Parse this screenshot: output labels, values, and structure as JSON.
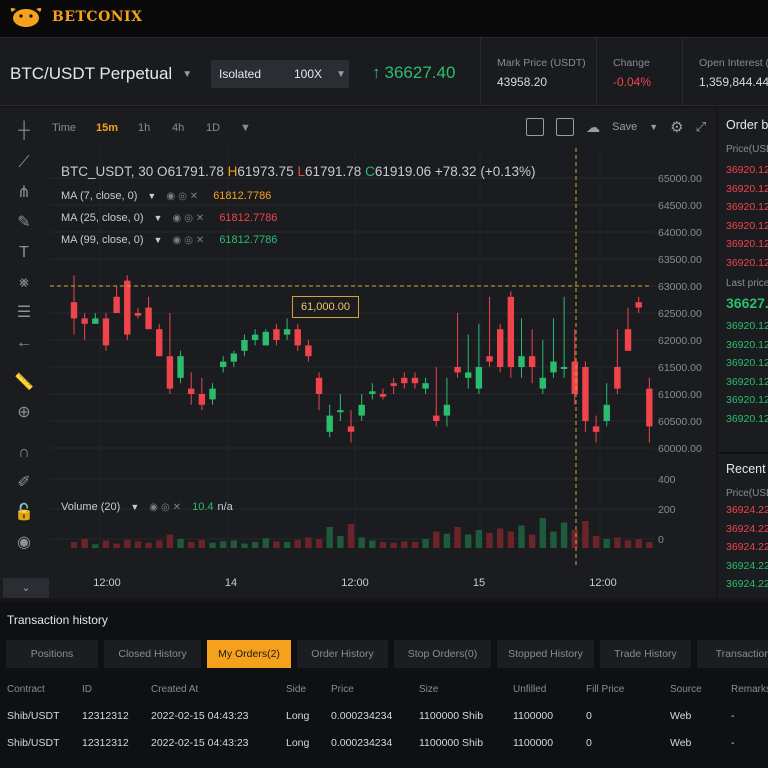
{
  "brand": {
    "name": "BETCONIX",
    "logo_icon": "bull-logo-icon"
  },
  "ticker": {
    "pair": "BTC/USDT Perpetual",
    "margin_mode": "Isolated",
    "leverage": "100X",
    "last_price": "36627.40",
    "stats": [
      {
        "label": "Mark Price (USDT)",
        "value": "43958.20",
        "negative": false
      },
      {
        "label": "Change",
        "value": "-0.04%",
        "negative": true
      },
      {
        "label": "Open Interest (U",
        "value": "1,359,844.44",
        "negative": false
      }
    ]
  },
  "chart_toolbar": {
    "timeframes": [
      "Time",
      "15m",
      "1h",
      "4h",
      "1D"
    ],
    "active_timeframe": "15m",
    "save_label": "Save"
  },
  "legend": {
    "symbol": "BTC_USDT, 30",
    "o_label": "O",
    "o": "61791.78",
    "h_label": "H",
    "h": "61973.75",
    "l_label": "L",
    "l": "61791.78",
    "c_label": "C",
    "c": "61919.06",
    "change": "+78.32",
    "change_pct": "(+0.13%)"
  },
  "indicators": [
    {
      "label": "MA (7, close, 0)",
      "value": "61812.7786",
      "color": "#f5a11c"
    },
    {
      "label": "MA (25, close, 0)",
      "value": "61812.7786",
      "color": "#f0444d"
    },
    {
      "label": "MA (99, close, 0)",
      "value": "61812.7786",
      "color": "#2bbd6e"
    }
  ],
  "volume_indicator": {
    "label": "Volume (20)",
    "value": "10.4",
    "extra": "n/a"
  },
  "crosshair_price": "61,000.00",
  "chart_data": {
    "type": "candlestick",
    "price_axis": [
      "65000.00",
      "64500.00",
      "64000.00",
      "63500.00",
      "63000.00",
      "62500.00",
      "62000.00",
      "61500.00",
      "61000.00",
      "60500.00",
      "60000.00"
    ],
    "volume_axis": [
      "400",
      "200",
      "0"
    ],
    "ylim": [
      60000,
      65000
    ],
    "x_labels": [
      "12:00",
      "14",
      "12:00",
      "15",
      "12:00"
    ],
    "candles": [
      [
        62700,
        63200,
        62100,
        62400
      ],
      [
        62400,
        62500,
        62000,
        62300
      ],
      [
        62300,
        62500,
        62300,
        62400
      ],
      [
        62400,
        62500,
        61800,
        61900
      ],
      [
        62800,
        63000,
        62500,
        62500
      ],
      [
        63100,
        63200,
        62000,
        62100
      ],
      [
        62500,
        62600,
        62400,
        62450
      ],
      [
        62600,
        62800,
        62200,
        62200
      ],
      [
        62200,
        62300,
        61700,
        61700
      ],
      [
        61700,
        62500,
        61000,
        61100
      ],
      [
        61300,
        61800,
        61200,
        61700
      ],
      [
        61100,
        61400,
        60800,
        61000
      ],
      [
        61000,
        61300,
        60700,
        60800
      ],
      [
        60900,
        61200,
        60800,
        61100
      ],
      [
        61500,
        61700,
        61400,
        61600
      ],
      [
        61600,
        61800,
        61500,
        61750
      ],
      [
        61800,
        62100,
        61700,
        62000
      ],
      [
        62000,
        62200,
        61900,
        62100
      ],
      [
        61900,
        62200,
        61900,
        62150
      ],
      [
        62200,
        62300,
        61900,
        62000
      ],
      [
        62100,
        62400,
        62000,
        62200
      ],
      [
        62200,
        62300,
        61800,
        61900
      ],
      [
        61900,
        62000,
        61600,
        61700
      ],
      [
        61300,
        61400,
        60700,
        61000
      ],
      [
        60300,
        60800,
        60200,
        60600
      ],
      [
        60700,
        61000,
        60500,
        60700
      ],
      [
        60400,
        60700,
        60100,
        60300
      ],
      [
        60600,
        61000,
        60500,
        60800
      ],
      [
        61000,
        61200,
        60900,
        61050
      ],
      [
        61000,
        61100,
        60900,
        60950
      ],
      [
        61200,
        61300,
        61000,
        61150
      ],
      [
        61300,
        61400,
        61100,
        61200
      ],
      [
        61300,
        61400,
        61100,
        61200
      ],
      [
        61100,
        61300,
        61000,
        61200
      ],
      [
        60600,
        61500,
        60400,
        60500
      ],
      [
        60600,
        61300,
        60400,
        60800
      ],
      [
        61500,
        62500,
        61300,
        61400
      ],
      [
        61300,
        62100,
        61100,
        61400
      ],
      [
        61100,
        62300,
        61000,
        61500
      ],
      [
        61700,
        62800,
        61500,
        61600
      ],
      [
        62200,
        62300,
        61400,
        61500
      ],
      [
        62800,
        62900,
        61300,
        61500
      ],
      [
        61500,
        62400,
        61300,
        61700
      ],
      [
        61700,
        62200,
        61200,
        61500
      ],
      [
        61100,
        62000,
        61000,
        61300
      ],
      [
        61400,
        62400,
        61300,
        61600
      ],
      [
        61500,
        62800,
        61300,
        61500
      ],
      [
        61600,
        62200,
        60800,
        61000
      ],
      [
        61500,
        61600,
        60300,
        60500
      ],
      [
        60400,
        60600,
        60100,
        60300
      ],
      [
        60500,
        61200,
        60400,
        60800
      ],
      [
        61500,
        62200,
        61000,
        61100
      ],
      [
        62200,
        62600,
        61800,
        61800
      ],
      [
        62700,
        62800,
        62500,
        62600
      ],
      [
        61100,
        61300,
        60100,
        60400
      ]
    ],
    "volumes": [
      40,
      60,
      25,
      50,
      30,
      55,
      45,
      35,
      50,
      90,
      60,
      40,
      55,
      35,
      45,
      50,
      30,
      40,
      65,
      45,
      40,
      55,
      70,
      60,
      140,
      80,
      160,
      70,
      50,
      40,
      35,
      45,
      40,
      60,
      110,
      95,
      140,
      90,
      120,
      100,
      130,
      110,
      150,
      90,
      200,
      110,
      170,
      120,
      180,
      80,
      60,
      70,
      50,
      60,
      40
    ]
  },
  "orderbook": {
    "title": "Order bo",
    "col": "Price(USD",
    "asks": [
      "36920.12",
      "36920.12",
      "36920.12",
      "36920.12",
      "36920.12",
      "36920.12"
    ],
    "last_label": "Last price",
    "last_value": "36627.",
    "bids": [
      "36920.12",
      "36920.12",
      "36920.12",
      "36920.12",
      "36920.12",
      "36920.12"
    ],
    "recent_title": "Recent T",
    "recent_col": "Price(USD",
    "recent": [
      {
        "p": "36924.22",
        "side": "red"
      },
      {
        "p": "36924.22",
        "side": "red"
      },
      {
        "p": "36924.22",
        "side": "red"
      },
      {
        "p": "36924.22",
        "side": "green"
      },
      {
        "p": "36924.22",
        "side": "green"
      }
    ]
  },
  "history": {
    "title": "Transaction history",
    "tabs": [
      "Positions",
      "Closed History",
      "My Orders(2)",
      "Order History",
      "Stop Orders(0)",
      "Stopped History",
      "Trade History",
      "Transactions"
    ],
    "active_tab": 2,
    "columns": [
      "Contract",
      "ID",
      "Created At",
      "Side",
      "Price",
      "Size",
      "Unfilled",
      "Fill Price",
      "Source",
      "Remarks"
    ],
    "rows": [
      [
        "Shib/USDT",
        "12312312",
        "2022-02-15 04:43:23",
        "Long",
        "0.000234234",
        "1100000 Shib",
        "1100000",
        "0",
        "Web",
        "-"
      ],
      [
        "Shib/USDT",
        "12312312",
        "2022-02-15 04:43:23",
        "Long",
        "0.000234234",
        "1100000 Shib",
        "1100000",
        "0",
        "Web",
        "-"
      ]
    ]
  }
}
